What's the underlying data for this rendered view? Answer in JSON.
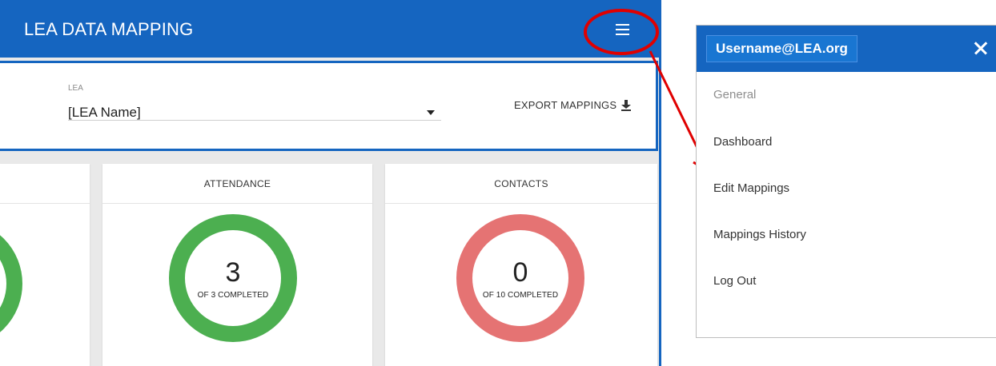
{
  "app": {
    "title": "LEA DATA MAPPING",
    "menu_icon": "hamburger-menu-icon"
  },
  "filter": {
    "lea_label": "LEA",
    "lea_value": "[LEA Name]",
    "export_label": "EXPORT MAPPINGS",
    "export_icon": "download-icon"
  },
  "cards": [
    {
      "title": "",
      "ring_color": "#4caf50"
    },
    {
      "title": "ATTENDANCE",
      "completed": "3",
      "summary": "OF 3 COMPLETED",
      "progress": 1.0,
      "ring_color": "#4caf50"
    },
    {
      "title": "CONTACTS",
      "completed": "0",
      "summary": "OF 10 COMPLETED",
      "progress": 0.0,
      "ring_color": "#e57373"
    }
  ],
  "drawer": {
    "username": "Username@LEA.org",
    "close_icon": "close-icon",
    "section": "General",
    "items": [
      "Dashboard",
      "Edit Mappings",
      "Mappings History",
      "Log Out"
    ]
  },
  "colors": {
    "primary": "#1565c0",
    "annotation": "#e00000",
    "complete": "#4caf50",
    "incomplete": "#e57373"
  }
}
